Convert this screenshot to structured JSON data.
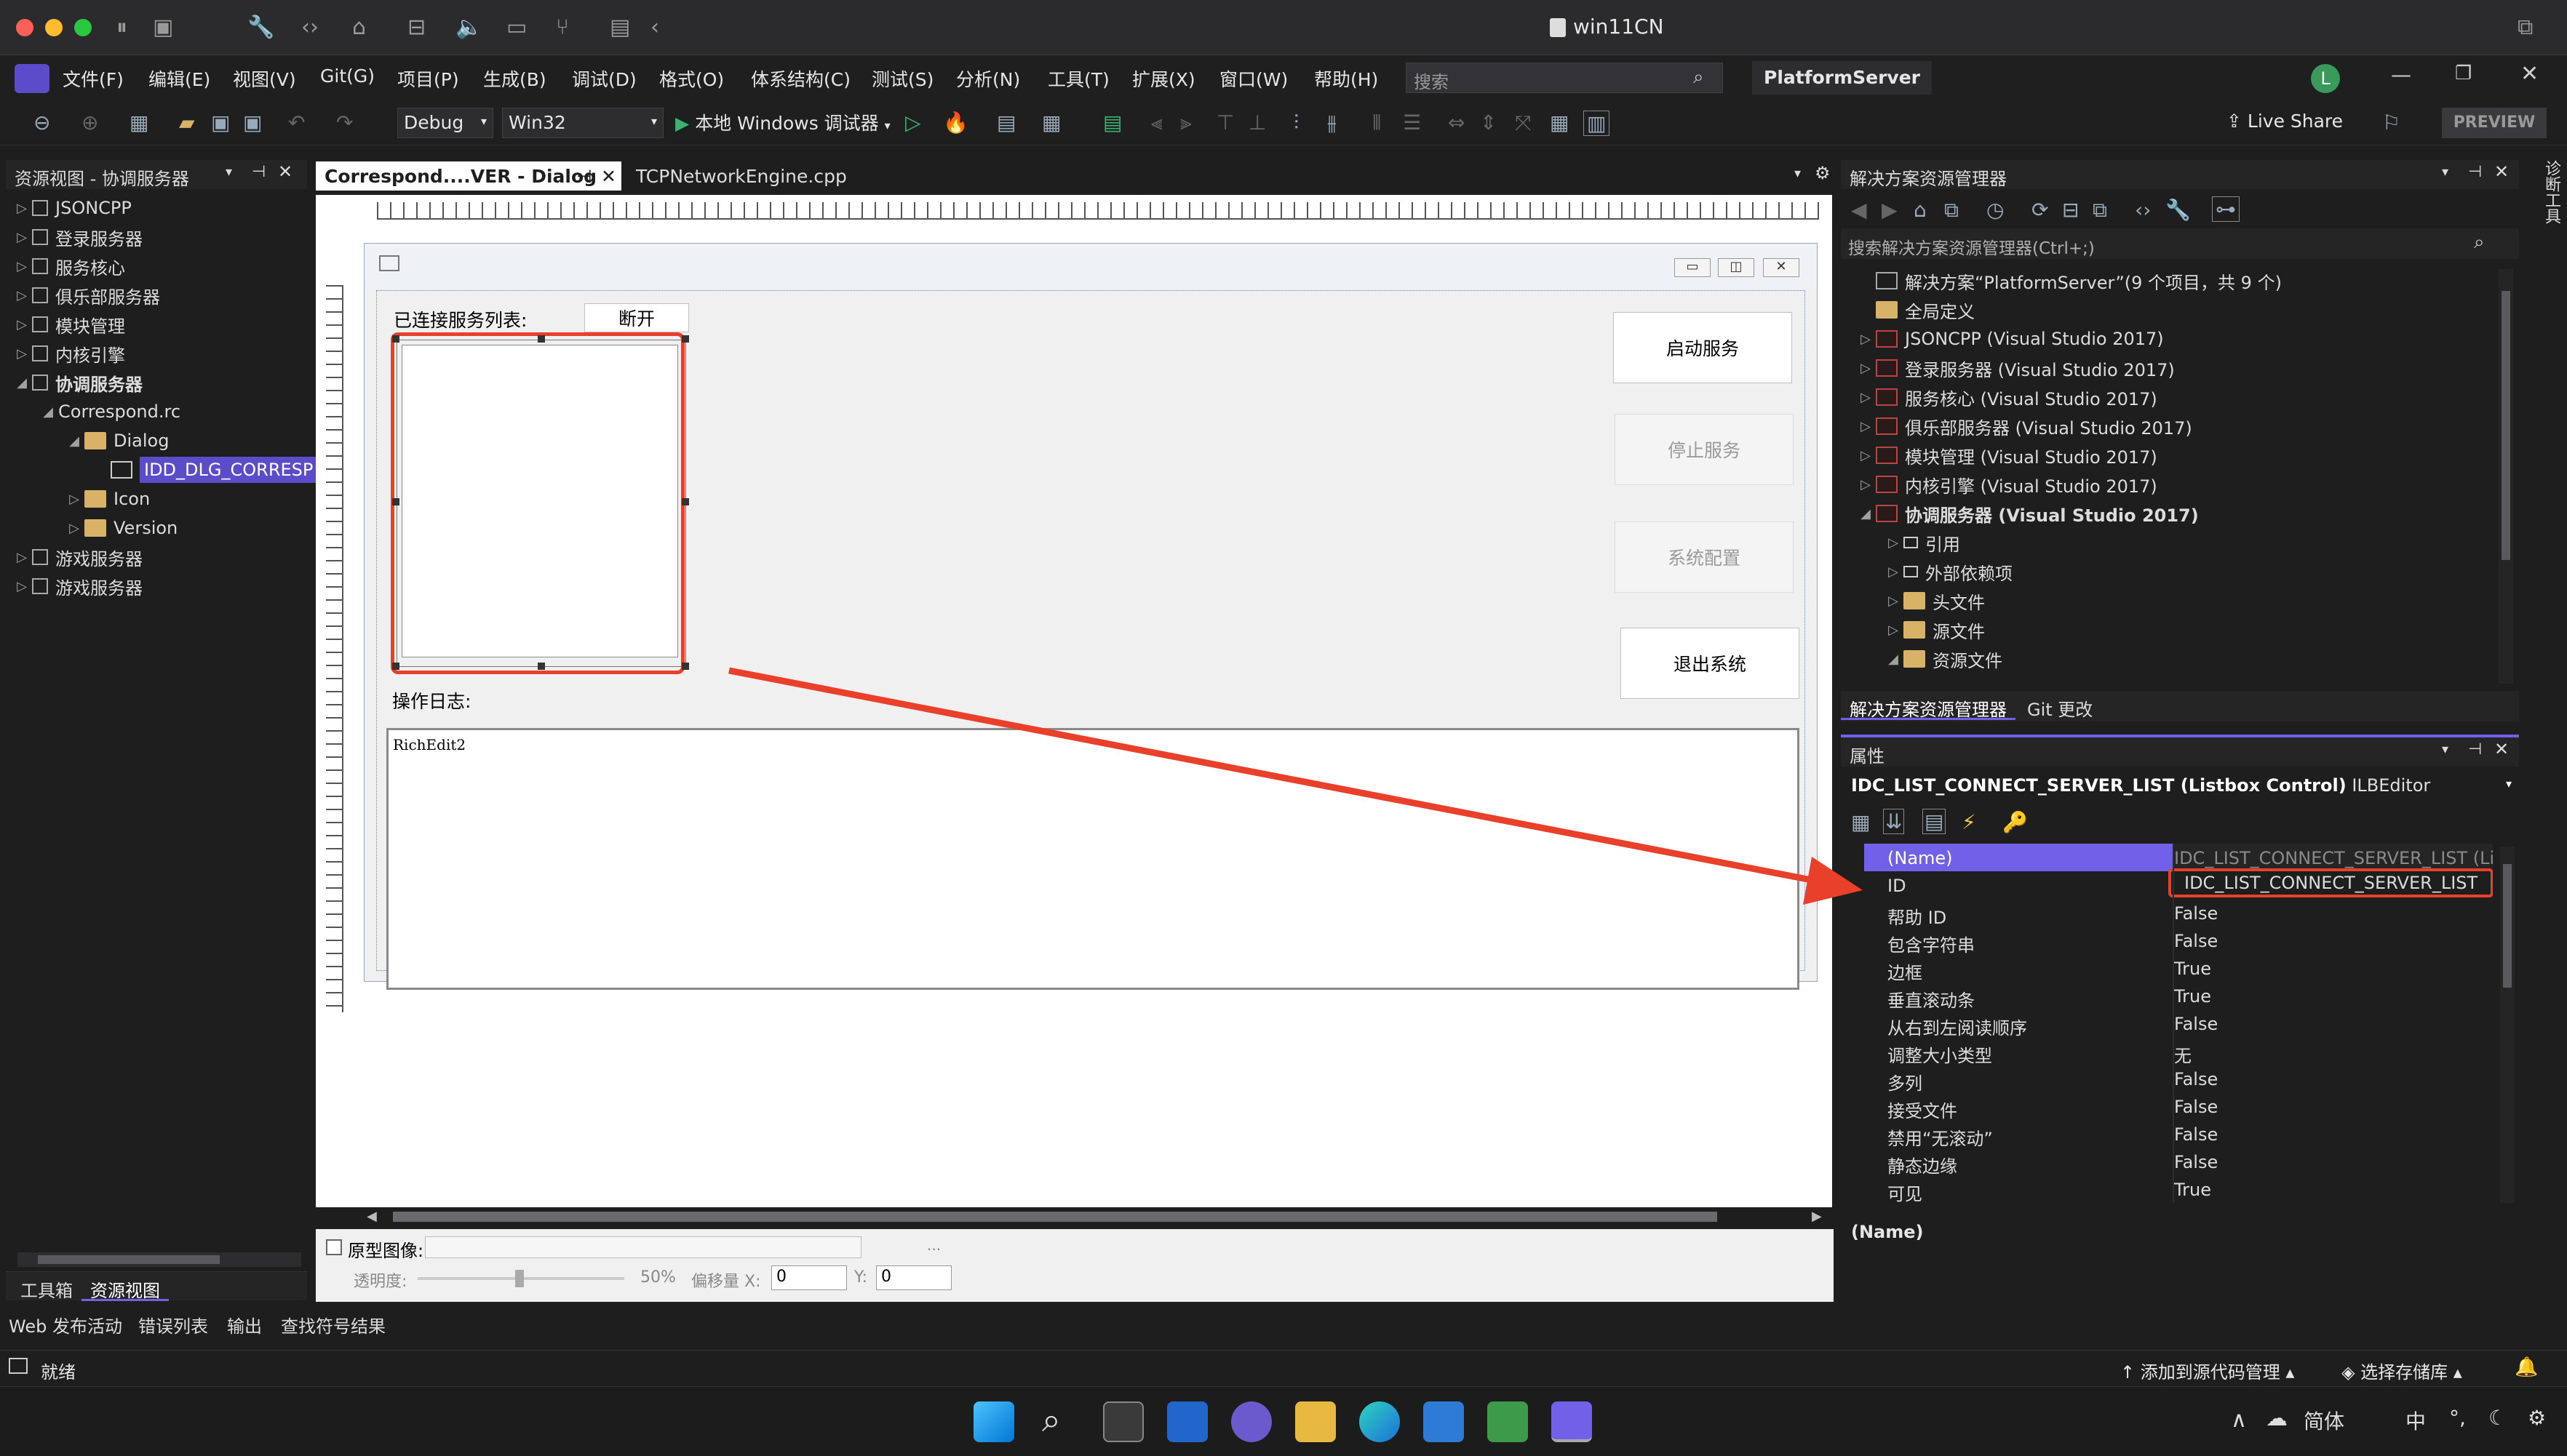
{
  "window": {
    "title": "win11CN"
  },
  "menu": {
    "items": [
      "文件(F)",
      "编辑(E)",
      "视图(V)",
      "Git(G)",
      "项目(P)",
      "生成(B)",
      "调试(D)",
      "格式(O)",
      "体系结构(C)",
      "测试(S)",
      "分析(N)",
      "工具(T)",
      "扩展(X)",
      "窗口(W)",
      "帮助(H)"
    ],
    "search_placeholder": "搜索",
    "solution_name": "PlatformServer",
    "user_initial": "L"
  },
  "toolbar": {
    "config": "Debug",
    "platform": "Win32",
    "debugger": "本地 Windows 调试器",
    "live_share": "Live Share",
    "preview": "PREVIEW"
  },
  "resource_view": {
    "title": "资源视图 - 协调服务器",
    "items": [
      {
        "label": "JSONCPP",
        "level": 0,
        "arrow": "▷"
      },
      {
        "label": "登录服务器",
        "level": 0,
        "arrow": "▷"
      },
      {
        "label": "服务核心",
        "level": 0,
        "arrow": "▷"
      },
      {
        "label": "俱乐部服务器",
        "level": 0,
        "arrow": "▷"
      },
      {
        "label": "模块管理",
        "level": 0,
        "arrow": "▷"
      },
      {
        "label": "内核引擎",
        "level": 0,
        "arrow": "▷"
      },
      {
        "label": "协调服务器",
        "level": 0,
        "arrow": "◢"
      },
      {
        "label": "Correspond.rc",
        "level": 1,
        "arrow": "◢"
      },
      {
        "label": "Dialog",
        "level": 2,
        "arrow": "◢"
      },
      {
        "label": "IDD_DLG_CORRESP",
        "level": 3,
        "arrow": ""
      },
      {
        "label": "Icon",
        "level": 2,
        "arrow": "▷"
      },
      {
        "label": "Version",
        "level": 2,
        "arrow": "▷"
      },
      {
        "label": "游戏服务器",
        "level": 0,
        "arrow": "▷"
      },
      {
        "label": "游戏服务器",
        "level": 0,
        "arrow": "▷"
      }
    ],
    "bottom_tabs": [
      "工具箱",
      "资源视图"
    ]
  },
  "editor": {
    "tabs": [
      "Correspond....VER - Dialog",
      "TCPNetworkEngine.cpp"
    ]
  },
  "dialog": {
    "connected_label": "已连接服务列表:",
    "disconnect_btn": "断开",
    "start_btn": "启动服务",
    "stop_btn": "停止服务",
    "config_btn": "系统配置",
    "exit_btn": "退出系统",
    "log_label": "操作日志:",
    "richedit_text": "RichEdit2"
  },
  "prototype": {
    "label": "原型图像:",
    "opacity_label": "透明度:",
    "opacity_value": "50%",
    "offset_label": "偏移量 X:",
    "x_value": "0",
    "y_label": "Y:",
    "y_value": "0",
    "browse": "..."
  },
  "output_tabs": [
    "Web 发布活动",
    "错误列表",
    "输出",
    "查找符号结果"
  ],
  "status": {
    "ready": "就绪",
    "add_source": "添加到源代码管理",
    "select_repo": "选择存储库"
  },
  "solution_explorer": {
    "title": "解决方案资源管理器",
    "search_placeholder": "搜索解决方案资源管理器(Ctrl+;)",
    "items": [
      {
        "label": "解决方案“PlatformServer”(9 个项目，共 9 个)",
        "level": 0,
        "arrow": "",
        "icon": "solution",
        "bold": false
      },
      {
        "label": "全局定义",
        "level": 0,
        "arrow": "",
        "icon": "folder",
        "bold": false
      },
      {
        "label": "JSONCPP (Visual Studio 2017)",
        "level": 0,
        "arrow": "▷",
        "icon": "proj",
        "bold": false
      },
      {
        "label": "登录服务器 (Visual Studio 2017)",
        "level": 0,
        "arrow": "▷",
        "icon": "proj",
        "bold": false
      },
      {
        "label": "服务核心 (Visual Studio 2017)",
        "level": 0,
        "arrow": "▷",
        "icon": "proj",
        "bold": false
      },
      {
        "label": "俱乐部服务器 (Visual Studio 2017)",
        "level": 0,
        "arrow": "▷",
        "icon": "proj",
        "bold": false
      },
      {
        "label": "模块管理 (Visual Studio 2017)",
        "level": 0,
        "arrow": "▷",
        "icon": "proj",
        "bold": false
      },
      {
        "label": "内核引擎 (Visual Studio 2017)",
        "level": 0,
        "arrow": "▷",
        "icon": "proj",
        "bold": false
      },
      {
        "label": "协调服务器 (Visual Studio 2017)",
        "level": 0,
        "arrow": "◢",
        "icon": "proj",
        "bold": true
      },
      {
        "label": "引用",
        "level": 1,
        "arrow": "▷",
        "icon": "ref",
        "bold": false
      },
      {
        "label": "外部依赖项",
        "level": 1,
        "arrow": "▷",
        "icon": "ref",
        "bold": false
      },
      {
        "label": "头文件",
        "level": 1,
        "arrow": "▷",
        "icon": "folder",
        "bold": false
      },
      {
        "label": "源文件",
        "level": 1,
        "arrow": "▷",
        "icon": "folder",
        "bold": false
      },
      {
        "label": "资源文件",
        "level": 1,
        "arrow": "◢",
        "icon": "folder",
        "bold": false
      }
    ],
    "bottom_tabs": [
      "解决方案资源管理器",
      "Git 更改"
    ]
  },
  "properties": {
    "title": "属性",
    "object": "IDC_LIST_CONNECT_SERVER_LIST (Listbox Control)",
    "editor": "ILBEditor",
    "rows": [
      {
        "k": "(Name)",
        "v": "IDC_LIST_CONNECT_SERVER_LIST (Lis"
      },
      {
        "k": "ID",
        "v": "IDC_LIST_CONNECT_SERVER_LIST"
      },
      {
        "k": "帮助 ID",
        "v": "False"
      },
      {
        "k": "包含字符串",
        "v": "False"
      },
      {
        "k": "边框",
        "v": "True"
      },
      {
        "k": "垂直滚动条",
        "v": "True"
      },
      {
        "k": "从右到左阅读顺序",
        "v": "False"
      },
      {
        "k": "调整大小类型",
        "v": "无"
      },
      {
        "k": "多列",
        "v": "False"
      },
      {
        "k": "接受文件",
        "v": "False"
      },
      {
        "k": "禁用“无滚动”",
        "v": "False"
      },
      {
        "k": "静态边缘",
        "v": "False"
      },
      {
        "k": "可见",
        "v": "True"
      }
    ],
    "description_title": "(Name)"
  },
  "side_tab": "诊断工具",
  "taskbar": {
    "lang": "简体",
    "ime_mode": "中"
  },
  "colors": {
    "accent": "#7160e8",
    "annotation": "#e8402a",
    "folder": "#d8b266"
  }
}
